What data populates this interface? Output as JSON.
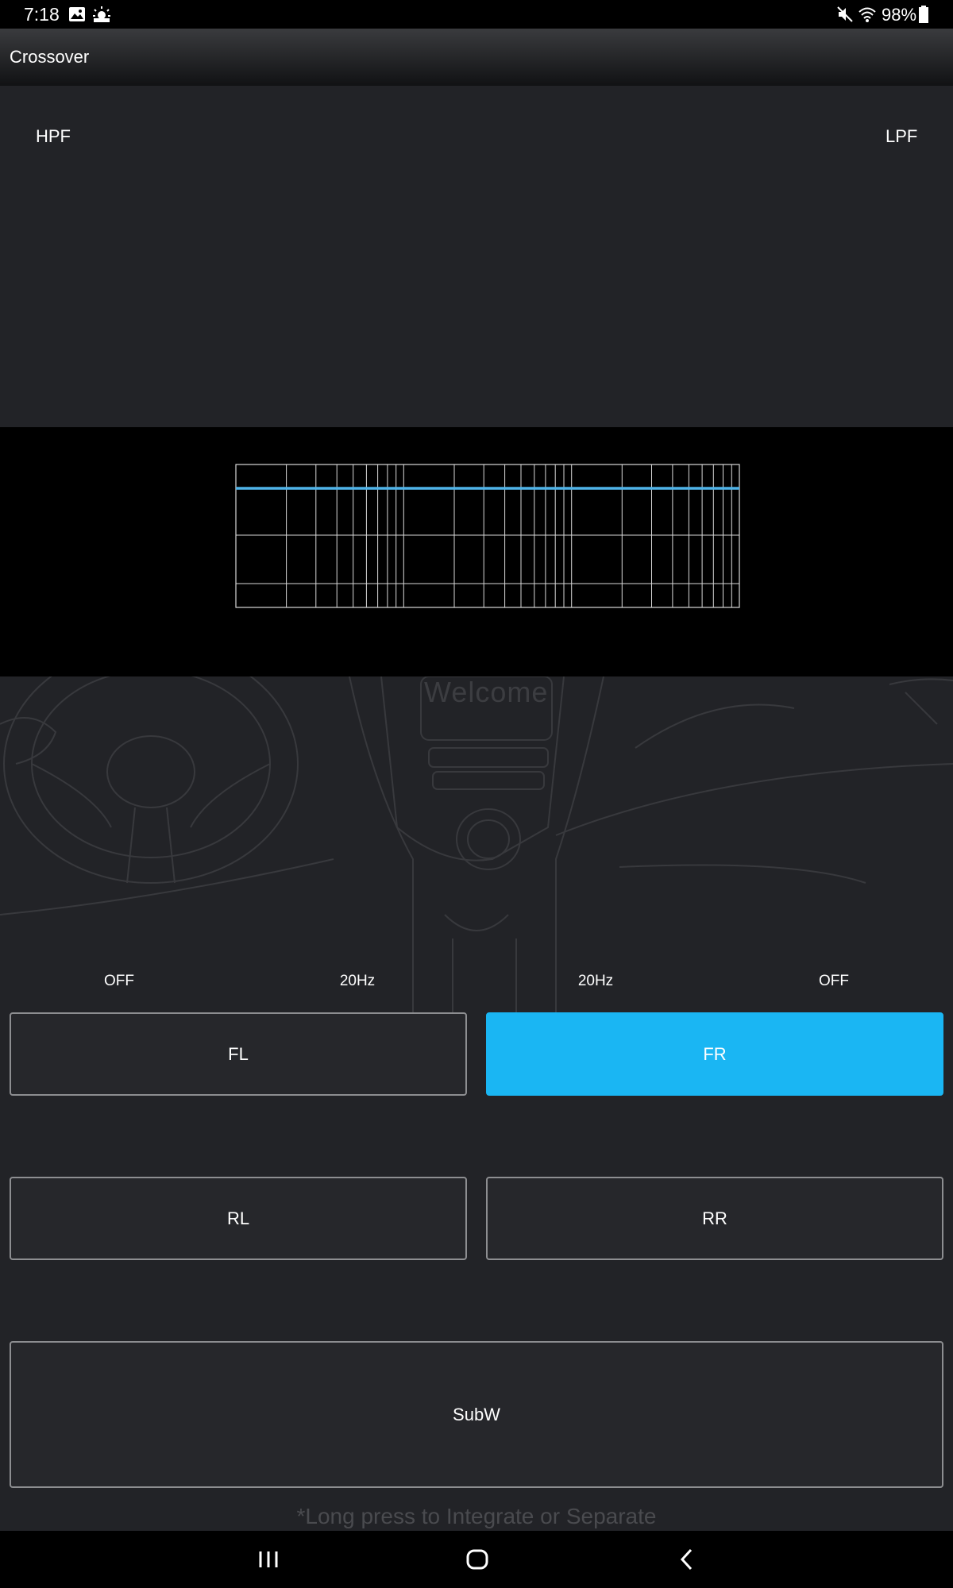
{
  "status_bar": {
    "time": "7:18",
    "battery_pct": "98%",
    "icons": [
      "image-icon",
      "weather-icon",
      "mute-icon",
      "wifi-icon",
      "battery-icon"
    ]
  },
  "app_bar": {
    "title": "Crossover"
  },
  "filters": {
    "hpf_label": "HPF",
    "lpf_label": "LPF"
  },
  "graph": {
    "line_color": "#4fb3e8",
    "grid_color": "#d9d9d9"
  },
  "art": {
    "welcome": "Welcome"
  },
  "freq_values": [
    "OFF",
    "20Hz",
    "20Hz",
    "OFF"
  ],
  "channels": {
    "fl": "FL",
    "fr": "FR",
    "rl": "RL",
    "rr": "RR",
    "subw": "SubW",
    "selected": "FR"
  },
  "hint": "*Long press to Integrate or Separate",
  "colors": {
    "accent": "#1ab6f3",
    "background": "#222327"
  },
  "nav_bar": {
    "icons": [
      "recents-icon",
      "home-icon",
      "back-icon"
    ]
  }
}
